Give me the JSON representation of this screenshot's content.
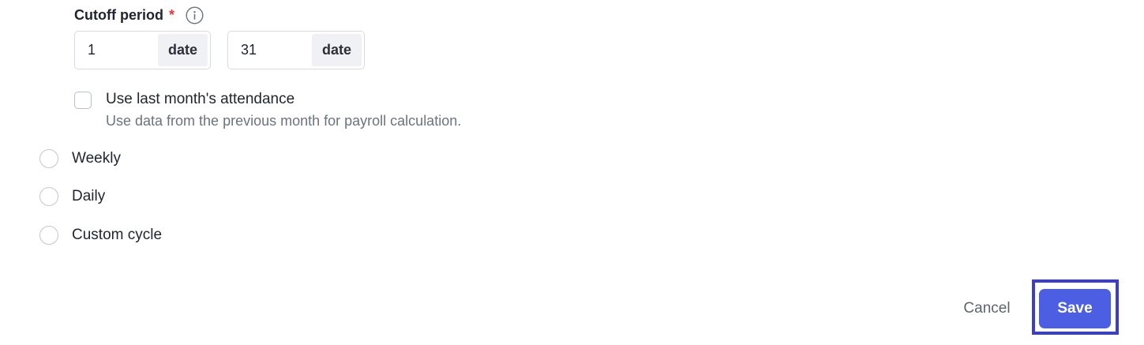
{
  "cutoff": {
    "label": "Cutoff period",
    "required_mark": "*",
    "start": {
      "value": "1",
      "suffix": "date"
    },
    "end": {
      "value": "31",
      "suffix": "date"
    }
  },
  "last_month": {
    "label": "Use last month's attendance",
    "description": "Use data from the previous month for payroll calculation.",
    "checked": false
  },
  "frequency_options": [
    {
      "label": "Weekly",
      "selected": false
    },
    {
      "label": "Daily",
      "selected": false
    },
    {
      "label": "Custom cycle",
      "selected": false
    }
  ],
  "actions": {
    "cancel_label": "Cancel",
    "save_label": "Save"
  },
  "colors": {
    "primary": "#4c5fe3",
    "required": "#e0393e",
    "focus_ring": "#3d3ec8"
  }
}
